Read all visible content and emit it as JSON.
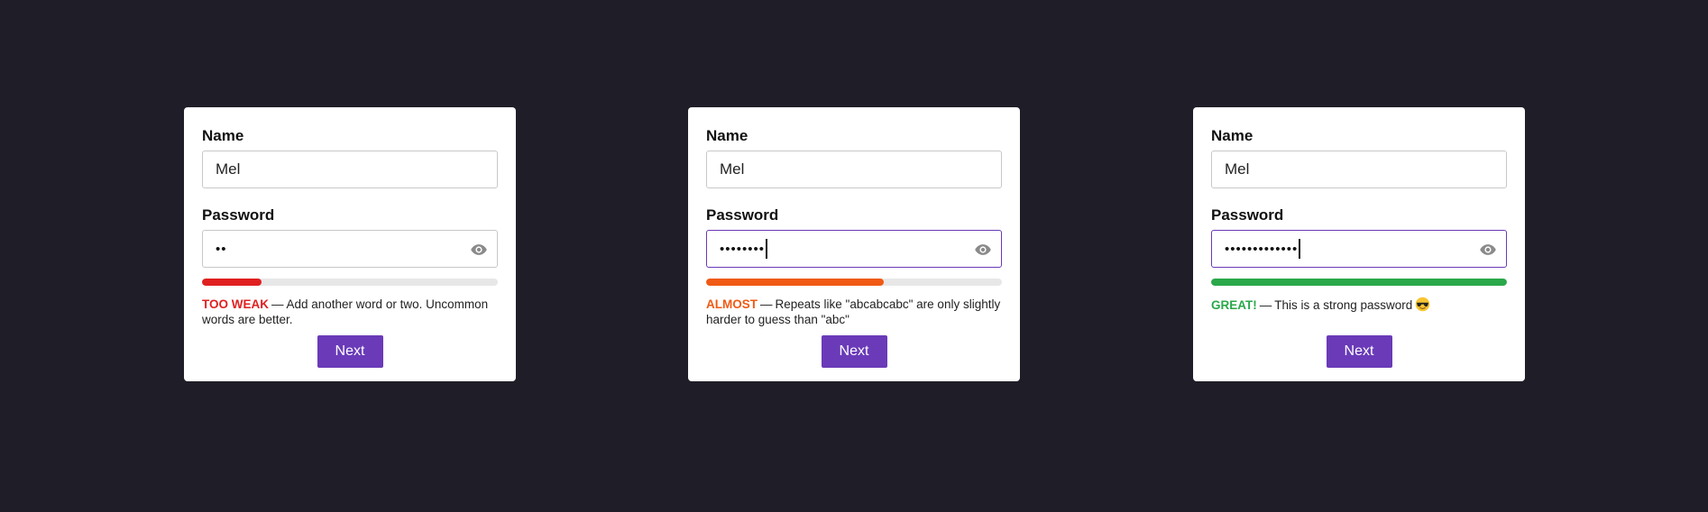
{
  "colors": {
    "background": "#1f1e28",
    "accent": "#6a3ab8",
    "weak": "#e02020",
    "almost": "#f05a14",
    "great": "#2aa84a",
    "track": "#e7e7e7"
  },
  "cards": [
    {
      "name_label": "Name",
      "name_value": "Mel",
      "password_label": "Password",
      "password_masked": "••",
      "password_focused": false,
      "strength_fraction": 0.2,
      "strength_color": "#e02020",
      "status": "TOO WEAK",
      "message": "Add another word or two. Uncommon words are better.",
      "button_label": "Next",
      "eye_icon": "eye-icon"
    },
    {
      "name_label": "Name",
      "name_value": "Mel",
      "password_label": "Password",
      "password_masked": "••••••••",
      "password_focused": true,
      "strength_fraction": 0.6,
      "strength_color": "#f05a14",
      "status": "ALMOST",
      "message": "Repeats like \"abcabcabc\" are only slightly harder to guess than \"abc\"",
      "button_label": "Next",
      "eye_icon": "eye-icon"
    },
    {
      "name_label": "Name",
      "name_value": "Mel",
      "password_label": "Password",
      "password_masked": "•••••••••••••",
      "password_focused": true,
      "strength_fraction": 1.0,
      "strength_color": "#2aa84a",
      "status": "GREAT!",
      "message": "This is a strong password",
      "message_emoji": "sunglasses-emoji-icon",
      "button_label": "Next",
      "eye_icon": "eye-icon"
    }
  ]
}
